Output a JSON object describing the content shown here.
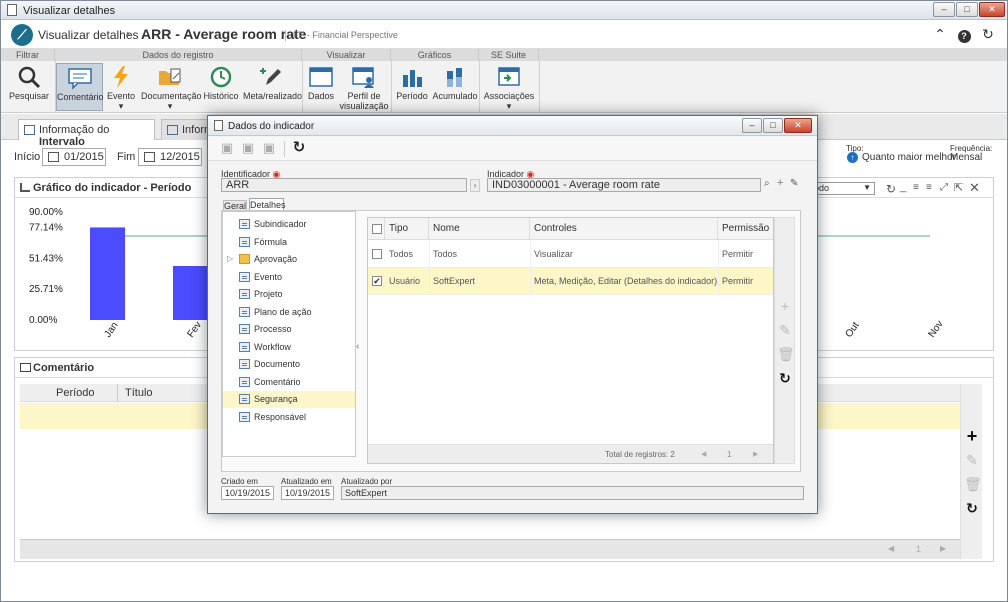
{
  "window": {
    "title": "Visualizar detalhes"
  },
  "header": {
    "crumb": "Visualizar detalhes",
    "title": "ARR - Average room rate",
    "perspective": "FP - Financial Perspective"
  },
  "ribbon": {
    "groups": {
      "filtrar": "Filtrar",
      "dados": "Dados do registro",
      "visualizar": "Visualizar",
      "graficos": "Gráficos",
      "suite": "SE Suite"
    },
    "buttons": {
      "pesquisar": "Pesquisar",
      "comentario": "Comentário",
      "evento": "Evento",
      "documentacao": "Documentação",
      "historico": "Histórico",
      "meta": "Meta/realizado",
      "dados": "Dados",
      "perfil1": "Perfil de",
      "perfil2": "visualização",
      "periodo": "Período",
      "acumulado": "Acumulado",
      "associacoes": "Associações"
    }
  },
  "tabs": {
    "t1_pre": "Informação do ",
    "t1_bold": "Intervalo",
    "t2": "Inform"
  },
  "filters": {
    "inicio_label": "Início",
    "inicio_value": "01/2015",
    "fim_label": "Fim",
    "fim_value": "12/2015",
    "tipo_label": "Tipo:",
    "tipo_value": "Quanto maior melhor",
    "freq_label": "Frequência:",
    "freq_value": "Mensal"
  },
  "chartPanel": {
    "title": "Gráfico do indicador - Período",
    "select_value": "odo"
  },
  "chart_data": {
    "type": "bar",
    "title": "Gráfico do indicador - Período",
    "yticks": [
      "90.00%",
      "77.14%",
      "51.43%",
      "25.71%",
      "0.00%"
    ],
    "categories": [
      "Jan",
      "Fev",
      "Out",
      "Nov"
    ],
    "values": [
      77.14,
      45,
      null,
      null
    ],
    "target": 70,
    "ylim": [
      0,
      90
    ],
    "colors": {
      "bar": "#4b4bff",
      "target": "#5fa8a0"
    }
  },
  "commentPanel": {
    "title": "Comentário",
    "col_periodo": "Período",
    "col_titulo": "Título",
    "pager": "1"
  },
  "dialog": {
    "title": "Dados do indicador",
    "identificador_label": "Identificador",
    "identificador_value": "ARR",
    "indicador_label": "Indicador",
    "indicador_value": "IND03000001 - Average room rate",
    "tab_geral": "Geral",
    "tab_detalhes": "Detalhes",
    "tree": [
      "Subindicador",
      "Fórmula",
      "Aprovação",
      "Evento",
      "Projeto",
      "Plano de ação",
      "Processo",
      "Workflow",
      "Documento",
      "Comentário",
      "Segurança",
      "Responsável"
    ],
    "grid": {
      "headers": {
        "tipo": "Tipo",
        "nome": "Nome",
        "controles": "Controles",
        "permissao": "Permissão"
      },
      "rows": [
        {
          "tipo": "Todos",
          "nome": "Todos",
          "controles": "Visualizar",
          "permissao": "Permitir"
        },
        {
          "tipo": "Usuário",
          "nome": "SoftExpert",
          "controles": "Meta, Medição, Editar (Detalhes do indicador)",
          "permissao": "Permitir"
        }
      ],
      "total": "Total de registros: 2",
      "page": "1"
    },
    "footer": {
      "criado_label": "Criado em",
      "criado_value": "10/19/2015",
      "atualizado_label": "Atualizado em",
      "atualizado_value": "10/19/2015",
      "por_label": "Atualizado por",
      "por_value": "SoftExpert"
    }
  }
}
